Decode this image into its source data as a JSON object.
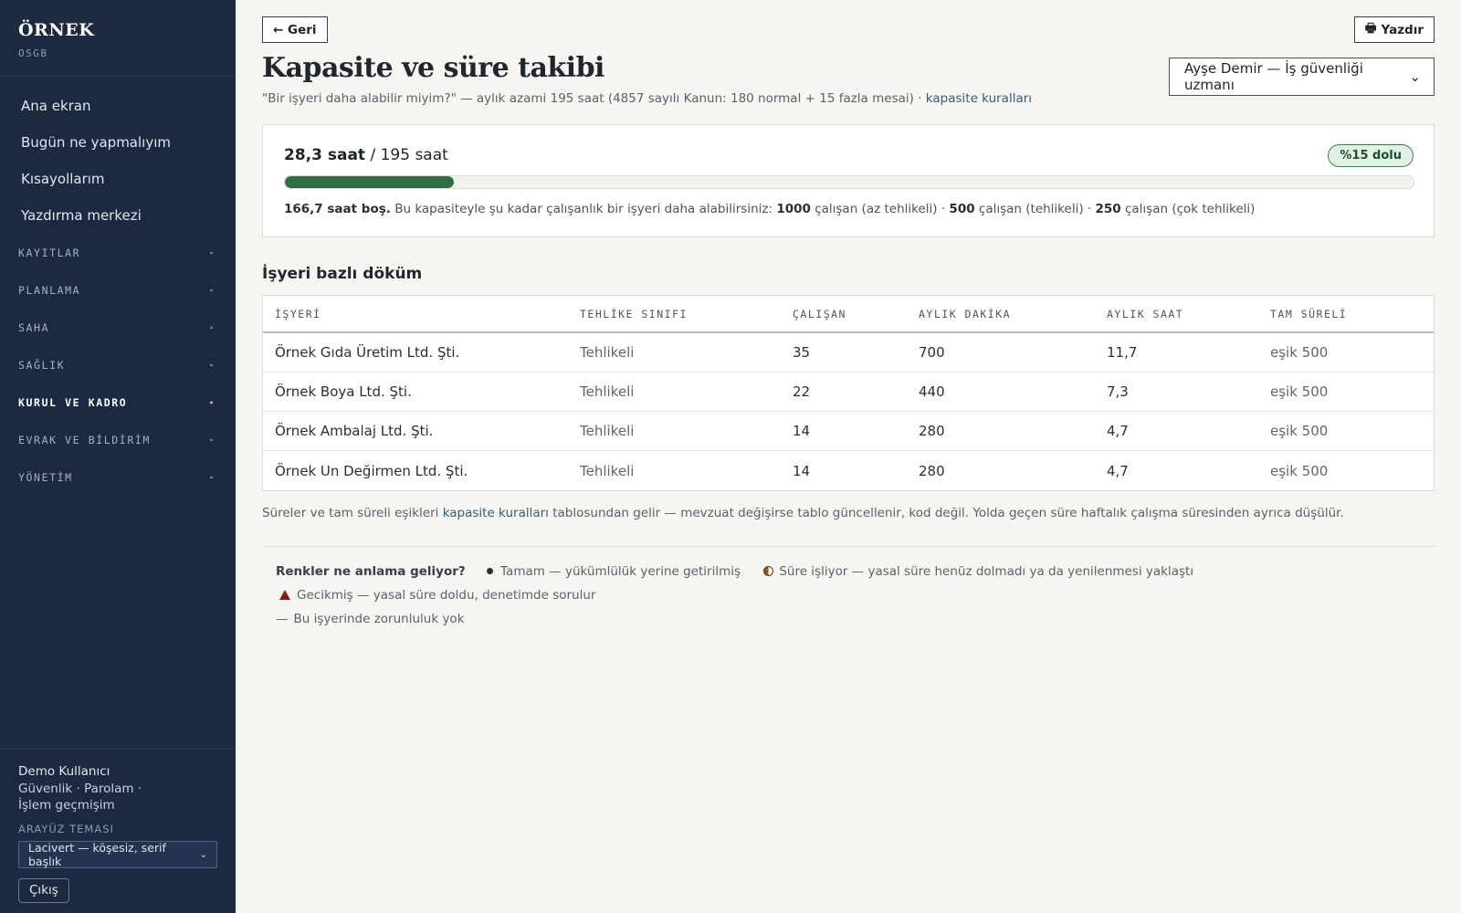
{
  "sidebar": {
    "brand": "ÖRNEK",
    "brand_sub": "OSGB",
    "main_items": [
      {
        "label": "Ana ekran"
      },
      {
        "label": "Bugün ne yapmalıyım"
      },
      {
        "label": "Kısayollarım"
      },
      {
        "label": "Yazdırma merkezi"
      }
    ],
    "groups": [
      {
        "label": "KAYITLAR",
        "caret": "▸"
      },
      {
        "label": "PLANLAMA",
        "caret": "▸"
      },
      {
        "label": "SAHA",
        "caret": "▸"
      },
      {
        "label": "SAĞLIK",
        "caret": "▸"
      },
      {
        "label": "KURUL VE KADRO",
        "caret": "▸"
      },
      {
        "label": "EVRAK VE BİLDİRİM",
        "caret": "▸"
      },
      {
        "label": "YÖNETİM",
        "caret": "▸"
      }
    ],
    "footer": {
      "user": "Demo Kullanıcı",
      "link_security": "Güvenlik ·",
      "link_password": "Parolam ·",
      "link_history": "İşlem geçmişim",
      "theme_label": "ARAYÜZ TEMASI",
      "theme_value": "Lacivert — köşesiz, serif başlık",
      "logout": "Çıkış"
    }
  },
  "topbar": {
    "back_label": "← Geri",
    "print_label": "Yazdır"
  },
  "header": {
    "title": "Kapasite ve süre takibi",
    "subtitle": "\"Bir işyeri daha alabilir miyim?\" — aylık azami 195 saat (4857 sayılı Kanun: 180 normal + 15 fazla mesai) ·",
    "subtitle_link": "kapasite kuralları",
    "person_select": "Ayşe Demir — İş güvenliği uzmanı"
  },
  "capacity": {
    "used": "28,3 saat",
    "total": "/ 195 saat",
    "badge": "%15 dolu",
    "fill_fraction": 0.15,
    "note_free": "166,7 saat boş.",
    "note_text": "Bu kapasiteyle şu kadar çalışanlık bir işyeri daha alabilirsiniz:",
    "n1": "1000",
    "t1": "çalışan (az tehlikeli) ·",
    "n2": "500",
    "t2": "çalışan (tehlikeli) ·",
    "n3": "250",
    "t3": "çalışan (çok tehlikeli)"
  },
  "breakdown": {
    "title": "İşyeri bazlı döküm",
    "columns": [
      "İŞYERİ",
      "TEHLİKE SINIFI",
      "ÇALIŞAN",
      "AYLIK DAKİKA",
      "AYLIK SAAT",
      "TAM SÜRELİ"
    ],
    "rows": [
      [
        "Örnek Gıda Üretim Ltd. Şti.",
        "Tehlikeli",
        "35",
        "700",
        "11,7",
        "eşik 500"
      ],
      [
        "Örnek Boya Ltd. Şti.",
        "Tehlikeli",
        "22",
        "440",
        "7,3",
        "eşik 500"
      ],
      [
        "Örnek Ambalaj Ltd. Şti.",
        "Tehlikeli",
        "14",
        "280",
        "4,7",
        "eşik 500"
      ],
      [
        "Örnek Un Değirmen Ltd. Şti.",
        "Tehlikeli",
        "14",
        "280",
        "4,7",
        "eşik 500"
      ]
    ],
    "note_pre": "Süreler ve tam süreli eşikleri",
    "note_link": "kapasite kuralları",
    "note_post": "tablosundan gelir — mevzuat değişirse tablo güncellenir, kod değil. Yolda geçen süre haftalık çalışma süresinden ayrıca düşülür."
  },
  "legend": {
    "title": "Renkler ne anlama geliyor?",
    "ok": "Tamam — yükümlülük yerine getirilmiş",
    "pending": "Süre işliyor — yasal süre henüz dolmadı ya da yenilenmesi yaklaştı",
    "late": "Gecikmiş — yasal süre doldu, denetimde sorulur",
    "none": "Bu işyerinde zorunluluk yok",
    "none_symbol": "—"
  },
  "colors": {
    "sidebar_bg": "#1c2940",
    "accent_green": "#2f6e41",
    "link": "#2e5e86",
    "late": "#7a2218"
  }
}
